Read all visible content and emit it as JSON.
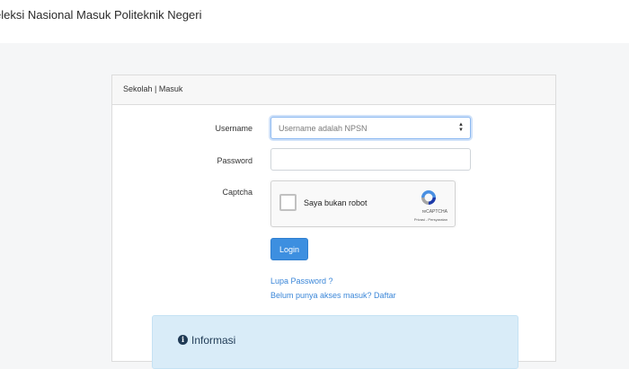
{
  "header": {
    "title": "eleksi Nasional Masuk Politeknik Negeri"
  },
  "card": {
    "title": "Sekolah | Masuk"
  },
  "form": {
    "username_label": "Username",
    "username_placeholder": "Username adalah NPSN",
    "password_label": "Password",
    "captcha_label": "Captcha",
    "login_label": "Login"
  },
  "captcha": {
    "checkbox_text": "Saya bukan robot",
    "brand": "reCAPTCHA",
    "links": "Privasi - Persyaratan",
    "icon": "recaptcha-logo-icon"
  },
  "links": {
    "forgot_password": "Lupa Password ?",
    "register": "Belum punya akses masuk? Daftar"
  },
  "info": {
    "title": "Informasi",
    "icon": "info-icon"
  },
  "colors": {
    "primary": "#3d8fe0",
    "link": "#3a86d8",
    "info_bg": "#d9ecf8"
  }
}
